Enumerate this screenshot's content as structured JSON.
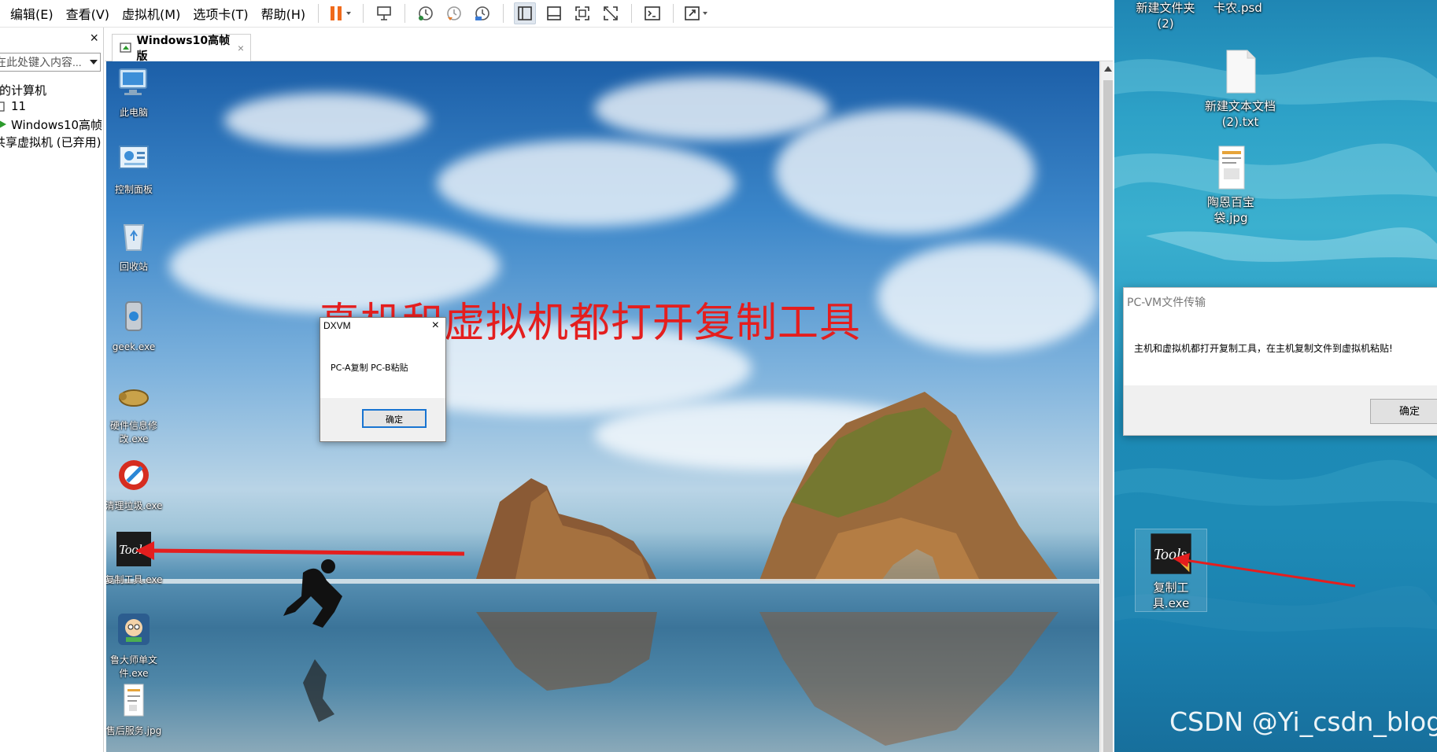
{
  "vmware": {
    "menu": [
      "编辑(E)",
      "查看(V)",
      "虚拟机(M)",
      "选项卡(T)",
      "帮助(H)"
    ],
    "library": {
      "close": "×",
      "search_placeholder": "在此处键入内容...",
      "tree": [
        "我的计算机",
        "11",
        "Windows10高帧",
        "共享虚拟机 (已弃用)"
      ]
    },
    "tab": {
      "label": "Windows10高帧版",
      "close": "×"
    }
  },
  "guest": {
    "icons": [
      "此电脑",
      "控制面板",
      "回收站",
      "geek.exe",
      "硬件信息修改.exe",
      "清理垃圾.exe",
      "复制工具.exe",
      "鲁大师单文件.exe",
      "售后服务.jpg"
    ],
    "overlay": "真机和虚拟机都打开复制工具",
    "dialog": {
      "title": "DXVM",
      "close": "×",
      "message": "PC-A复制 PC-B粘贴",
      "ok": "确定"
    }
  },
  "host": {
    "icons": [
      "新建文件夹 (2)",
      "卡农.psd",
      "新建文本文档 (2).txt",
      "陶恩百宝袋.jpg",
      "复制工具.exe"
    ],
    "dialog": {
      "title": "PC-VM文件传输",
      "message": "主机和虚拟机都打开复制工具，在主机复制文件到虚拟机粘贴!",
      "ok": "确定"
    },
    "watermark": "CSDN @Yi_csdn_blog"
  },
  "colors": {
    "annotation": "#e41e1e",
    "dialog_focus": "#1874d1"
  }
}
